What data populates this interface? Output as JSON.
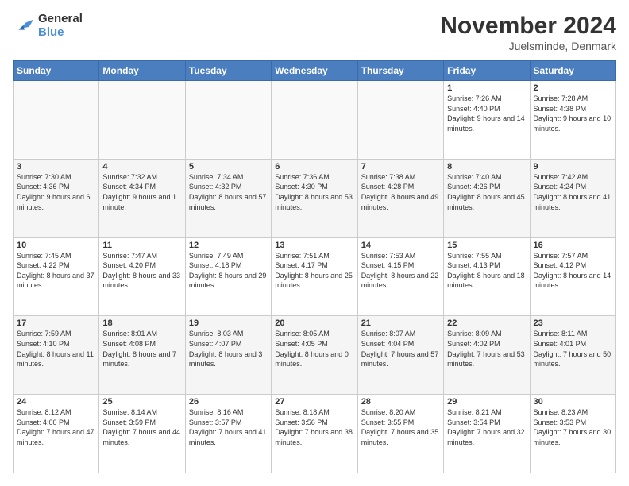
{
  "logo": {
    "text_general": "General",
    "text_blue": "Blue"
  },
  "header": {
    "month_year": "November 2024",
    "location": "Juelsminde, Denmark"
  },
  "days_of_week": [
    "Sunday",
    "Monday",
    "Tuesday",
    "Wednesday",
    "Thursday",
    "Friday",
    "Saturday"
  ],
  "weeks": [
    [
      {
        "day": "",
        "info": ""
      },
      {
        "day": "",
        "info": ""
      },
      {
        "day": "",
        "info": ""
      },
      {
        "day": "",
        "info": ""
      },
      {
        "day": "",
        "info": ""
      },
      {
        "day": "1",
        "info": "Sunrise: 7:26 AM\nSunset: 4:40 PM\nDaylight: 9 hours and 14 minutes."
      },
      {
        "day": "2",
        "info": "Sunrise: 7:28 AM\nSunset: 4:38 PM\nDaylight: 9 hours and 10 minutes."
      }
    ],
    [
      {
        "day": "3",
        "info": "Sunrise: 7:30 AM\nSunset: 4:36 PM\nDaylight: 9 hours and 6 minutes."
      },
      {
        "day": "4",
        "info": "Sunrise: 7:32 AM\nSunset: 4:34 PM\nDaylight: 9 hours and 1 minute."
      },
      {
        "day": "5",
        "info": "Sunrise: 7:34 AM\nSunset: 4:32 PM\nDaylight: 8 hours and 57 minutes."
      },
      {
        "day": "6",
        "info": "Sunrise: 7:36 AM\nSunset: 4:30 PM\nDaylight: 8 hours and 53 minutes."
      },
      {
        "day": "7",
        "info": "Sunrise: 7:38 AM\nSunset: 4:28 PM\nDaylight: 8 hours and 49 minutes."
      },
      {
        "day": "8",
        "info": "Sunrise: 7:40 AM\nSunset: 4:26 PM\nDaylight: 8 hours and 45 minutes."
      },
      {
        "day": "9",
        "info": "Sunrise: 7:42 AM\nSunset: 4:24 PM\nDaylight: 8 hours and 41 minutes."
      }
    ],
    [
      {
        "day": "10",
        "info": "Sunrise: 7:45 AM\nSunset: 4:22 PM\nDaylight: 8 hours and 37 minutes."
      },
      {
        "day": "11",
        "info": "Sunrise: 7:47 AM\nSunset: 4:20 PM\nDaylight: 8 hours and 33 minutes."
      },
      {
        "day": "12",
        "info": "Sunrise: 7:49 AM\nSunset: 4:18 PM\nDaylight: 8 hours and 29 minutes."
      },
      {
        "day": "13",
        "info": "Sunrise: 7:51 AM\nSunset: 4:17 PM\nDaylight: 8 hours and 25 minutes."
      },
      {
        "day": "14",
        "info": "Sunrise: 7:53 AM\nSunset: 4:15 PM\nDaylight: 8 hours and 22 minutes."
      },
      {
        "day": "15",
        "info": "Sunrise: 7:55 AM\nSunset: 4:13 PM\nDaylight: 8 hours and 18 minutes."
      },
      {
        "day": "16",
        "info": "Sunrise: 7:57 AM\nSunset: 4:12 PM\nDaylight: 8 hours and 14 minutes."
      }
    ],
    [
      {
        "day": "17",
        "info": "Sunrise: 7:59 AM\nSunset: 4:10 PM\nDaylight: 8 hours and 11 minutes."
      },
      {
        "day": "18",
        "info": "Sunrise: 8:01 AM\nSunset: 4:08 PM\nDaylight: 8 hours and 7 minutes."
      },
      {
        "day": "19",
        "info": "Sunrise: 8:03 AM\nSunset: 4:07 PM\nDaylight: 8 hours and 3 minutes."
      },
      {
        "day": "20",
        "info": "Sunrise: 8:05 AM\nSunset: 4:05 PM\nDaylight: 8 hours and 0 minutes."
      },
      {
        "day": "21",
        "info": "Sunrise: 8:07 AM\nSunset: 4:04 PM\nDaylight: 7 hours and 57 minutes."
      },
      {
        "day": "22",
        "info": "Sunrise: 8:09 AM\nSunset: 4:02 PM\nDaylight: 7 hours and 53 minutes."
      },
      {
        "day": "23",
        "info": "Sunrise: 8:11 AM\nSunset: 4:01 PM\nDaylight: 7 hours and 50 minutes."
      }
    ],
    [
      {
        "day": "24",
        "info": "Sunrise: 8:12 AM\nSunset: 4:00 PM\nDaylight: 7 hours and 47 minutes."
      },
      {
        "day": "25",
        "info": "Sunrise: 8:14 AM\nSunset: 3:59 PM\nDaylight: 7 hours and 44 minutes."
      },
      {
        "day": "26",
        "info": "Sunrise: 8:16 AM\nSunset: 3:57 PM\nDaylight: 7 hours and 41 minutes."
      },
      {
        "day": "27",
        "info": "Sunrise: 8:18 AM\nSunset: 3:56 PM\nDaylight: 7 hours and 38 minutes."
      },
      {
        "day": "28",
        "info": "Sunrise: 8:20 AM\nSunset: 3:55 PM\nDaylight: 7 hours and 35 minutes."
      },
      {
        "day": "29",
        "info": "Sunrise: 8:21 AM\nSunset: 3:54 PM\nDaylight: 7 hours and 32 minutes."
      },
      {
        "day": "30",
        "info": "Sunrise: 8:23 AM\nSunset: 3:53 PM\nDaylight: 7 hours and 30 minutes."
      }
    ]
  ]
}
